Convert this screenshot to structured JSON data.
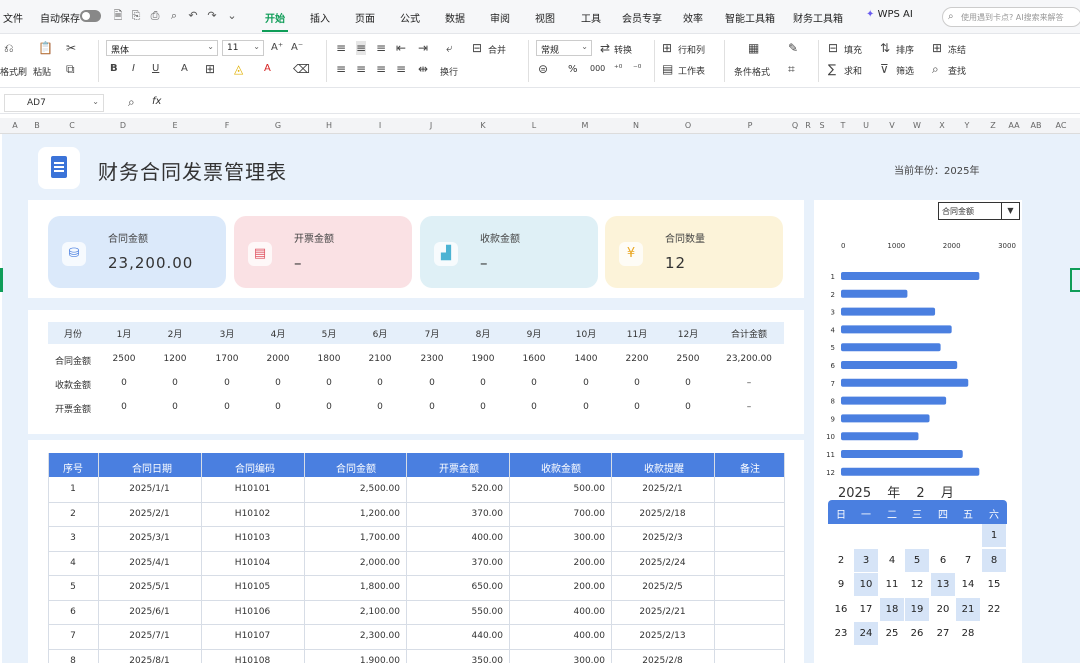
{
  "menubar": {
    "file": "文件",
    "autosave": "自动保存",
    "tabs": [
      "开始",
      "插入",
      "页面",
      "公式",
      "数据",
      "审阅",
      "视图",
      "工具",
      "会员专享",
      "效率",
      "智能工具箱",
      "财务工具箱"
    ],
    "wps_ai": "WPS AI",
    "search_placeholder": "使用遇到卡点? AI搜索来解答"
  },
  "toolbar": {
    "format_painter": "格式刷",
    "paste": "粘贴",
    "font_name": "黑体",
    "font_size": "11",
    "wrap": "换行",
    "merge": "合并",
    "number_format": "常规",
    "convert": "转换",
    "row_col": "行和列",
    "worksheet": "工作表",
    "cond_format": "条件格式",
    "fill": "填充",
    "sort": "排序",
    "freeze": "冻结",
    "sum": "求和",
    "filter": "筛选",
    "find": "查找",
    "percent": "%",
    "decimals": "000"
  },
  "formula_bar": {
    "name_box": "AD7",
    "fx": "fx"
  },
  "columns": [
    "A",
    "B",
    "C",
    "D",
    "E",
    "F",
    "G",
    "H",
    "I",
    "J",
    "K",
    "L",
    "M",
    "N",
    "O",
    "P",
    "Q",
    "R",
    "S",
    "T",
    "U",
    "V",
    "W",
    "X",
    "Y",
    "Z",
    "AA",
    "AB",
    "AC"
  ],
  "page": {
    "title": "财务合同发票管理表",
    "year_label": "当前年份：",
    "year_value": "2025年"
  },
  "kpis": [
    {
      "label": "合同金额",
      "value": "23,200.00",
      "icon": "database-icon",
      "bg": "#dbe9fa",
      "icon_color": "#4a7fe0"
    },
    {
      "label": "开票金额",
      "value": "–",
      "icon": "document-icon",
      "bg": "#fae1e4",
      "icon_color": "#e05563"
    },
    {
      "label": "收款金额",
      "value": "–",
      "icon": "bar-chart-icon",
      "bg": "#dff0f6",
      "icon_color": "#4bb3d3"
    },
    {
      "label": "合同数量",
      "value": "12",
      "icon": "yen-icon",
      "bg": "#fcf3d9",
      "icon_color": "#e9a51f"
    }
  ],
  "monthly": {
    "headers": [
      "月份",
      "1月",
      "2月",
      "3月",
      "4月",
      "5月",
      "6月",
      "7月",
      "8月",
      "9月",
      "10月",
      "11月",
      "12月",
      "合计金额"
    ],
    "rows": [
      {
        "label": "合同金额",
        "values": [
          "2500",
          "1200",
          "1700",
          "2000",
          "1800",
          "2100",
          "2300",
          "1900",
          "1600",
          "1400",
          "2200",
          "2500"
        ],
        "total": "23,200.00"
      },
      {
        "label": "收款金额",
        "values": [
          "0",
          "0",
          "0",
          "0",
          "0",
          "0",
          "0",
          "0",
          "0",
          "0",
          "0",
          "0"
        ],
        "total": "–"
      },
      {
        "label": "开票金额",
        "values": [
          "0",
          "0",
          "0",
          "0",
          "0",
          "0",
          "0",
          "0",
          "0",
          "0",
          "0",
          "0"
        ],
        "total": "–"
      }
    ]
  },
  "detail": {
    "headers": [
      "序号",
      "合同日期",
      "合同编码",
      "合同金额",
      "开票金额",
      "收款金额",
      "收款提醒",
      "备注"
    ],
    "rows": [
      [
        "1",
        "2025/1/1",
        "H10101",
        "2,500.00",
        "520.00",
        "500.00",
        "2025/2/1",
        ""
      ],
      [
        "2",
        "2025/2/1",
        "H10102",
        "1,200.00",
        "370.00",
        "700.00",
        "2025/2/18",
        ""
      ],
      [
        "3",
        "2025/3/1",
        "H10103",
        "1,700.00",
        "400.00",
        "300.00",
        "2025/2/3",
        ""
      ],
      [
        "4",
        "2025/4/1",
        "H10104",
        "2,000.00",
        "370.00",
        "200.00",
        "2025/2/24",
        ""
      ],
      [
        "5",
        "2025/5/1",
        "H10105",
        "1,800.00",
        "650.00",
        "200.00",
        "2025/2/5",
        ""
      ],
      [
        "6",
        "2025/6/1",
        "H10106",
        "2,100.00",
        "550.00",
        "400.00",
        "2025/2/21",
        ""
      ],
      [
        "7",
        "2025/7/1",
        "H10107",
        "2,300.00",
        "440.00",
        "400.00",
        "2025/2/13",
        ""
      ],
      [
        "8",
        "2025/8/1",
        "H10108",
        "1,900.00",
        "350.00",
        "300.00",
        "2025/2/8",
        ""
      ]
    ]
  },
  "right_panel": {
    "dropdown_value": "合同金额"
  },
  "chart_data": {
    "type": "bar",
    "orientation": "horizontal",
    "categories": [
      "1",
      "2",
      "3",
      "4",
      "5",
      "6",
      "7",
      "8",
      "9",
      "10",
      "11",
      "12"
    ],
    "values": [
      2500,
      1200,
      1700,
      2000,
      1800,
      2100,
      2300,
      1900,
      1600,
      1400,
      2200,
      2500
    ],
    "xticks": [
      "0",
      "1000",
      "2000",
      "3000"
    ],
    "xlim": [
      0,
      3000
    ],
    "bar_color": "#4a7fe0",
    "grid": false
  },
  "calendar": {
    "year": "2025",
    "year_unit": "年",
    "month": "2",
    "month_unit": "月",
    "weekdays": [
      "日",
      "一",
      "二",
      "三",
      "四",
      "五",
      "六"
    ],
    "weeks": [
      [
        "",
        "",
        "",
        "",
        "",
        "",
        "1"
      ],
      [
        "2",
        "3",
        "4",
        "5",
        "6",
        "7",
        "8"
      ],
      [
        "9",
        "10",
        "11",
        "12",
        "13",
        "14",
        "15"
      ],
      [
        "16",
        "17",
        "18",
        "19",
        "20",
        "21",
        "22"
      ],
      [
        "23",
        "24",
        "25",
        "26",
        "27",
        "28",
        ""
      ]
    ],
    "highlighted": [
      "1",
      "3",
      "5",
      "8",
      "10",
      "13",
      "18",
      "19",
      "21",
      "24"
    ]
  },
  "colors": {
    "accent": "#4a7fe0",
    "ribbon_active": "#0f9d58",
    "sheet_bg": "#e8f1fb"
  }
}
